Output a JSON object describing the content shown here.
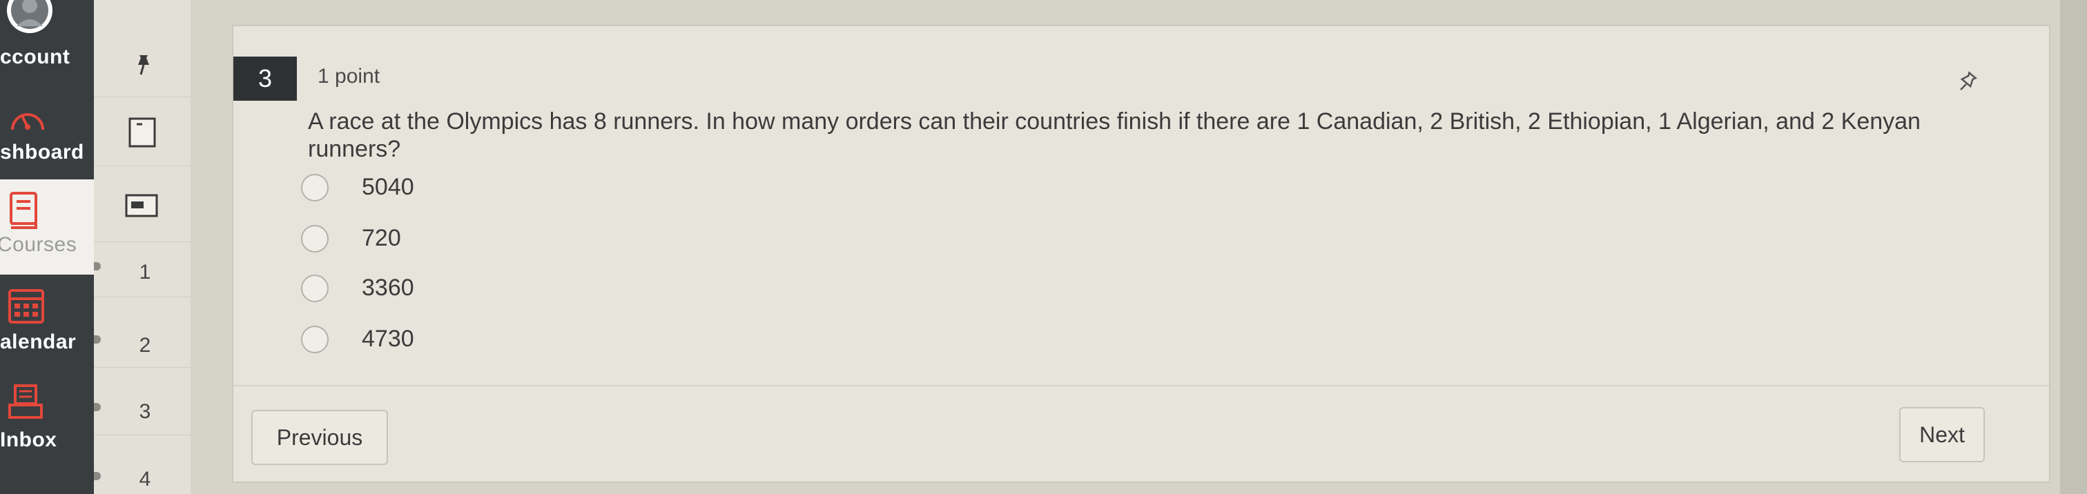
{
  "global_nav": {
    "items": [
      {
        "label": "ccount",
        "icon": "avatar-icon"
      },
      {
        "label": "shboard",
        "icon": "dashboard-icon"
      },
      {
        "label": "Courses",
        "icon": "book-icon"
      },
      {
        "label": "alendar",
        "icon": "calendar-icon"
      },
      {
        "label": "Inbox",
        "icon": "inbox-icon"
      }
    ]
  },
  "question_list": {
    "pin_icon": "pushpin-icon",
    "items": [
      "1",
      "2",
      "3",
      "4"
    ]
  },
  "question": {
    "number": "3",
    "points": "1 point",
    "text": "A race at the Olympics has 8 runners. In how many orders can their countries finish if there are 1 Canadian, 2 British, 2 Ethiopian, 1 Algerian, and 2 Kenyan runners?",
    "answers": [
      "5040",
      "720",
      "3360",
      "4730"
    ]
  },
  "footer": {
    "previous_label": "Previous",
    "next_label": "Next"
  },
  "colors": {
    "nav_bg": "#393d40",
    "card_bg": "#e7e4db",
    "question_badge": "#2f3235"
  }
}
